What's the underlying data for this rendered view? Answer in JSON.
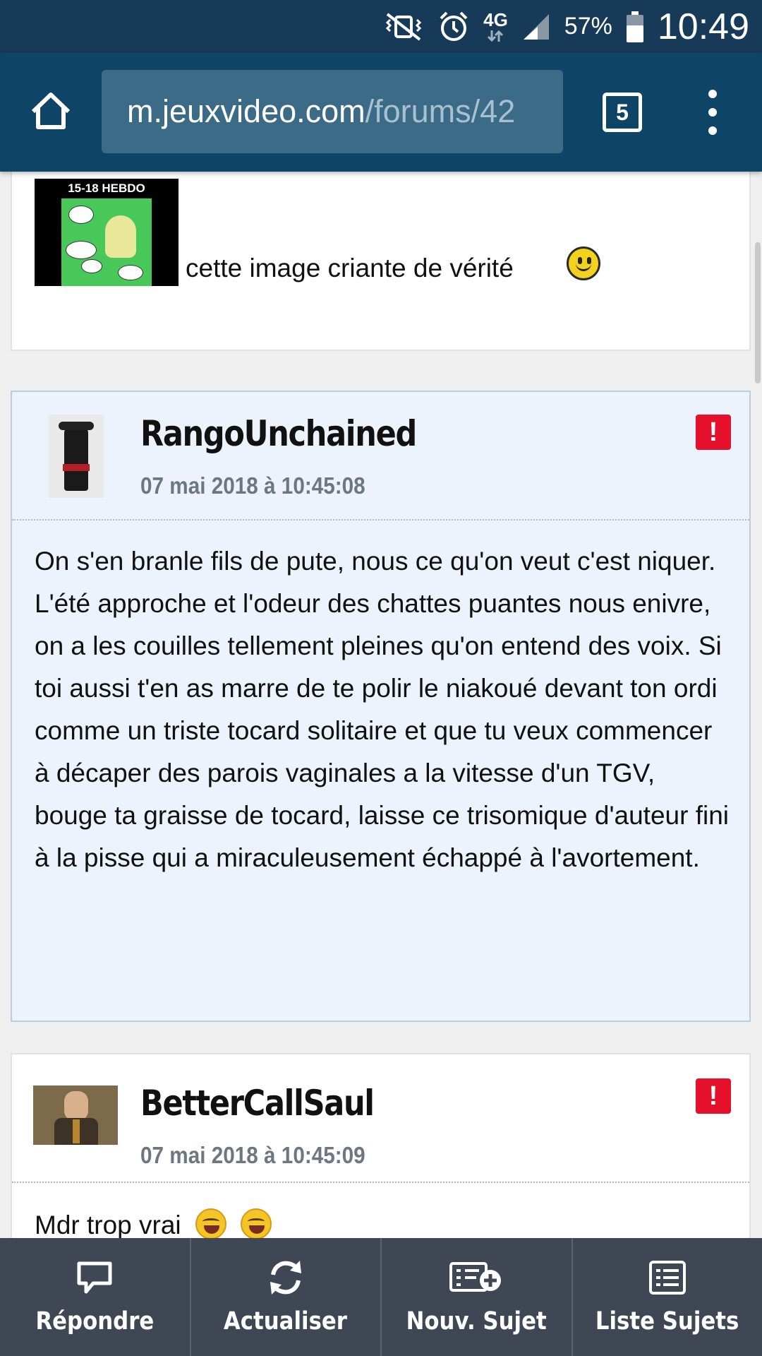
{
  "status_bar": {
    "icons": [
      "vibrate-mute-icon",
      "alarm-icon",
      "network-4g-icon",
      "signal-icon",
      "battery-icon"
    ],
    "network": "4G",
    "battery": "57%",
    "clock": "10:49"
  },
  "browser": {
    "url_domain": "m.jeuxvideo.com",
    "url_path": "/forums/42",
    "tab_count": "5"
  },
  "posts": [
    {
      "image_title": "15-18 HEBDO",
      "text": "cette image criante de vérité"
    },
    {
      "author": "RangoUnchained",
      "date": "07 mai 2018 à 10:45:08",
      "alert": "!",
      "text": "On s'en branle fils de pute, nous ce qu'on veut c'est niquer. L'été approche et l'odeur des chattes puantes nous enivre, on a les couilles tellement pleines qu'on entend des voix. Si toi aussi t'en as marre de te polir le niakoué devant ton ordi comme un triste tocard solitaire et que tu veux commencer à décaper des parois vaginales a la vitesse d'un TGV, bouge ta graisse de tocard, laisse ce trisomique d'auteur fini à la pisse qui a miraculeusement échappé à l'avortement."
    },
    {
      "author": "BetterCallSaul",
      "date": "07 mai 2018 à 10:45:09",
      "alert": "!",
      "text": "Mdr trop vrai"
    }
  ],
  "bottom_bar": [
    {
      "label": "Répondre",
      "icon": "reply-bubble-icon"
    },
    {
      "label": "Actualiser",
      "icon": "refresh-icon"
    },
    {
      "label": "Nouv. Sujet",
      "icon": "new-topic-icon"
    },
    {
      "label": "Liste Sujets",
      "icon": "topic-list-icon"
    }
  ],
  "colors": {
    "toolbar": "#0e4566",
    "status_bar": "#163a57",
    "highlight_post": "#edf3fc",
    "alert": "#e5102b",
    "bottom_bar": "#3f4654"
  }
}
